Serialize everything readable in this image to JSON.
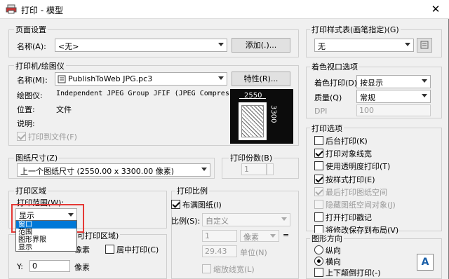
{
  "window": {
    "title": "打印 - 模型",
    "close": "✕"
  },
  "page_setup": {
    "group": "页面设置",
    "name_label": "名称(A):",
    "name_value": "<无>",
    "add_button": "添加(.)..."
  },
  "printer": {
    "group": "打印机/绘图仪",
    "name_label": "名称(M):",
    "name_value": "PublishToWeb JPG.pc3",
    "props_button": "特性(R)...",
    "plotter_label": "绘图仪:",
    "plotter_value": "Independent JPEG Group JFIF (JPEG Compressi...",
    "location_label": "位置:",
    "location_value": "文件",
    "desc_label": "说明:",
    "print_to_file": "打印到文件(F)",
    "preview_width": "2550",
    "preview_height": "3300"
  },
  "paper": {
    "group": "图纸尺寸(Z)",
    "value": "上一个图纸尺寸  (2550.00 x 3300.00 像素)",
    "copies_label": "打印份数(B)",
    "copies_value": "1"
  },
  "plot_area": {
    "group": "打印区域",
    "range_label": "打印范围(W):",
    "range_value": "显示",
    "dropdown_options": [
      "窗口",
      "范围",
      "图形界限",
      "显示"
    ],
    "offset_label": "可打印区域)",
    "x_suffix": "像素",
    "center_label": "居中打印(C)",
    "y_label": "Y:",
    "y_value": "0",
    "y_suffix": "像素"
  },
  "scale": {
    "group": "打印比例",
    "fit_label": "布满图纸(I)",
    "scale_label": "比例(S):",
    "scale_value": "自定义",
    "num_value": "1",
    "unit_value": "像素",
    "equals": "=",
    "den_value": "29.43",
    "den_unit": "单位(N)",
    "lineweight_label": "缩放线宽(L)"
  },
  "style_table": {
    "group": "打印样式表(画笔指定)(G)",
    "value": "无"
  },
  "shaded": {
    "group": "着色视口选项",
    "shade_label": "着色打印(D)",
    "shade_value": "按显示",
    "quality_label": "质量(Q)",
    "quality_value": "常规",
    "dpi_label": "DPI",
    "dpi_value": "100"
  },
  "options": {
    "group": "打印选项",
    "items": [
      {
        "label": "后台打印(K)",
        "checked": false,
        "enabled": true
      },
      {
        "label": "打印对象线宽",
        "checked": true,
        "enabled": true
      },
      {
        "label": "使用透明度打印(T)",
        "checked": false,
        "enabled": true
      },
      {
        "label": "按样式打印(E)",
        "checked": true,
        "enabled": true
      },
      {
        "label": "最后打印图纸空间",
        "checked": true,
        "enabled": false
      },
      {
        "label": "隐藏图纸空间对象(J)",
        "checked": false,
        "enabled": false
      },
      {
        "label": "打开打印戳记",
        "checked": false,
        "enabled": true
      },
      {
        "label": "将修改保存到布局(V)",
        "checked": false,
        "enabled": true
      }
    ]
  },
  "orientation": {
    "group": "图形方向",
    "portrait": "纵向",
    "landscape": "横向",
    "upside_down": "上下颠倒打印(-)",
    "icon_letter": "A"
  }
}
